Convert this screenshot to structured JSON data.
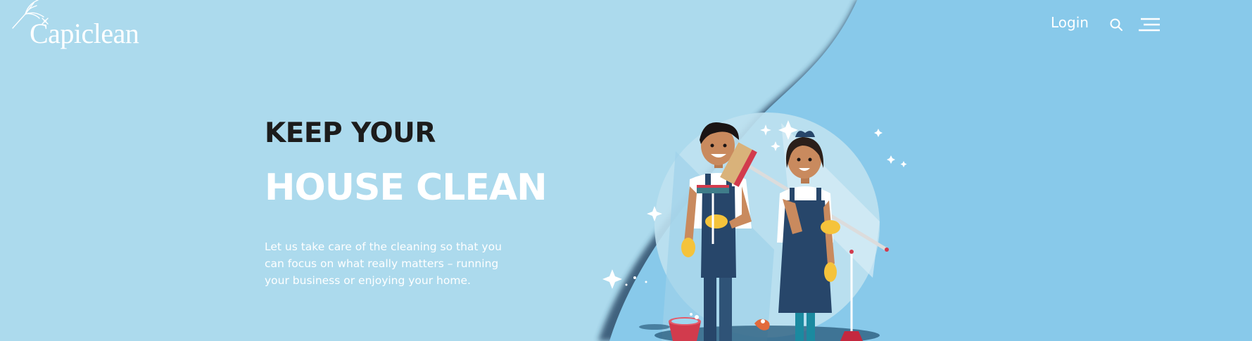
{
  "brand": {
    "name": "Capiclean",
    "icon": "feather-duster-icon"
  },
  "nav": {
    "login_label": "Login",
    "search_icon": "search-icon",
    "menu_icon": "hamburger-menu-icon"
  },
  "hero": {
    "line1": "KEEP YOUR",
    "line2": "HOUSE CLEAN",
    "description": "Let us take care of the cleaning so that you can focus on what really matters – running your business or enjoying your home."
  },
  "colors": {
    "background_left": "#acdaed",
    "background_right": "#88c9ea",
    "heading_dark": "#1c1c1c",
    "heading_light": "#ffffff",
    "uniform_navy": "#27466a",
    "glove_yellow": "#f5c33b"
  }
}
